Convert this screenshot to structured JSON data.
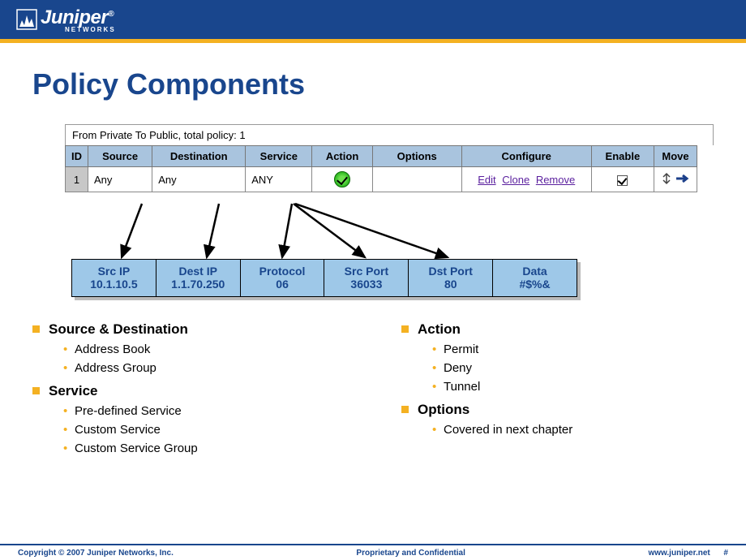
{
  "brand": {
    "name": "Juniper",
    "sub": "NETWORKS"
  },
  "title": "Policy Components",
  "policy": {
    "caption": "From Private To Public, total policy: 1",
    "headers": {
      "id": "ID",
      "source": "Source",
      "destination": "Destination",
      "service": "Service",
      "action": "Action",
      "options": "Options",
      "configure": "Configure",
      "enable": "Enable",
      "move": "Move"
    },
    "row": {
      "id": "1",
      "source": "Any",
      "destination": "Any",
      "service": "ANY",
      "options": "",
      "configure": {
        "edit": "Edit",
        "clone": "Clone",
        "remove": "Remove"
      }
    }
  },
  "packet": [
    {
      "label": "Src IP",
      "value": "10.1.10.5"
    },
    {
      "label": "Dest IP",
      "value": "1.1.70.250"
    },
    {
      "label": "Protocol",
      "value": "06"
    },
    {
      "label": "Src Port",
      "value": "36033"
    },
    {
      "label": "Dst Port",
      "value": "80"
    },
    {
      "label": "Data",
      "value": "#$%&"
    }
  ],
  "bullets_left": [
    {
      "h": "Source & Destination",
      "items": [
        "Address Book",
        "Address Group"
      ]
    },
    {
      "h": "Service",
      "items": [
        "Pre-defined Service",
        "Custom Service",
        "Custom Service Group"
      ]
    }
  ],
  "bullets_right": [
    {
      "h": "Action",
      "items": [
        "Permit",
        "Deny",
        "Tunnel"
      ]
    },
    {
      "h": "Options",
      "items": [
        "Covered in next chapter"
      ]
    }
  ],
  "footer": {
    "left": "Copyright © 2007 Juniper Networks, Inc.",
    "center": "Proprietary and Confidential",
    "right": "www.juniper.net"
  },
  "page_num": "#"
}
